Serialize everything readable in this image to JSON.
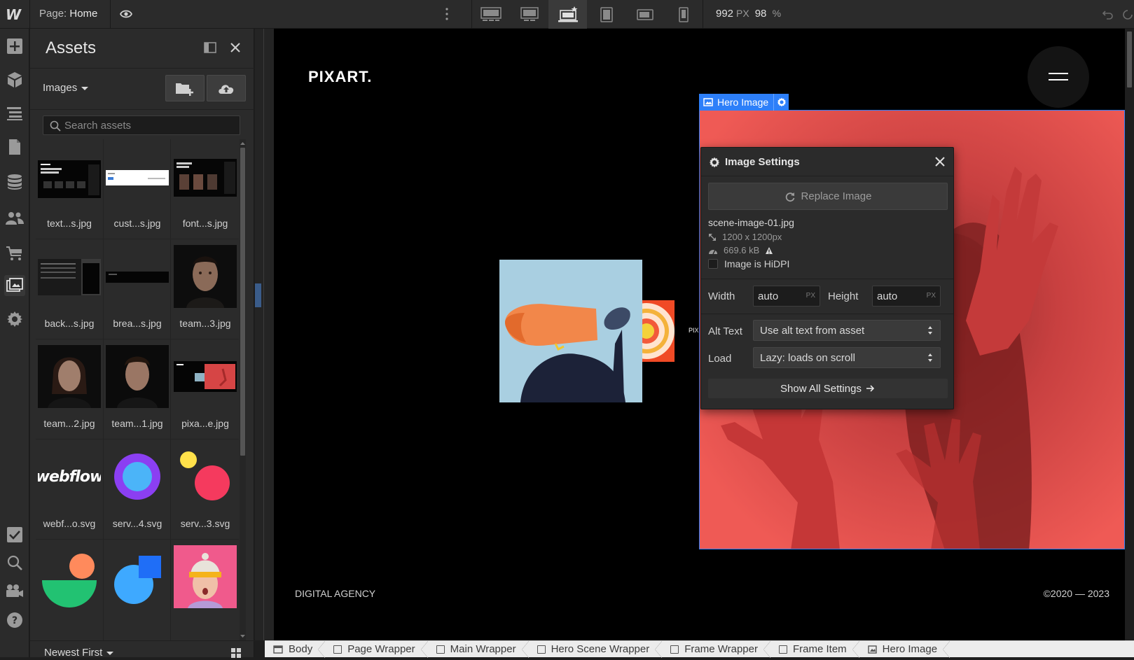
{
  "topbar": {
    "logo": "W",
    "page_label": "Page:",
    "page_name": "Home",
    "width_value": "992",
    "width_unit": "PX",
    "zoom_value": "98",
    "zoom_unit": "%",
    "breakpoints": [
      "desktop-large-icon",
      "desktop-icon",
      "laptop-base-icon",
      "tablet-icon",
      "mobile-landscape-icon",
      "mobile-portrait-icon"
    ],
    "active_breakpoint": "laptop-base-icon"
  },
  "leftbar": {
    "items": [
      "add-icon",
      "navigator-cube-icon",
      "style-list-icon",
      "pages-icon",
      "cms-database-icon",
      "users-icon",
      "ecommerce-cart-icon",
      "assets-icon",
      "settings-gear-icon"
    ],
    "bottom_items": [
      "checklist-icon",
      "search-icon",
      "video-tutorials-icon",
      "help-icon"
    ]
  },
  "assets_panel": {
    "title": "Assets",
    "filter": "Images",
    "search_placeholder": "Search assets",
    "sort": "Newest First",
    "assets": [
      {
        "name": "text...s.jpg"
      },
      {
        "name": "cust...s.jpg"
      },
      {
        "name": "font...s.jpg"
      },
      {
        "name": "back...s.jpg"
      },
      {
        "name": "brea...s.jpg"
      },
      {
        "name": "team...3.jpg"
      },
      {
        "name": "team...2.jpg"
      },
      {
        "name": "team...1.jpg"
      },
      {
        "name": "pixa...e.jpg"
      },
      {
        "name": "webf...o.svg",
        "thumb_text": "webflow"
      },
      {
        "name": "serv...4.svg"
      },
      {
        "name": "serv...3.svg"
      },
      {
        "name": ""
      },
      {
        "name": ""
      },
      {
        "name": ""
      }
    ]
  },
  "canvas": {
    "brand": "PIXART.",
    "footer_left": "DIGITAL AGENCY",
    "footer_right": "©2020 — 2023",
    "side_label": "PIX",
    "selected_label": "Hero Image"
  },
  "image_settings": {
    "title": "Image Settings",
    "replace_label": "Replace Image",
    "file_name": "scene-image-01.jpg",
    "dimensions": "1200 x 1200px",
    "file_size": "669.6 kB",
    "hidpi_label": "Image is HiDPI",
    "hidpi_checked": false,
    "width_label": "Width",
    "width_value": "auto",
    "width_unit": "PX",
    "height_label": "Height",
    "height_value": "auto",
    "height_unit": "PX",
    "alt_label": "Alt Text",
    "alt_value": "Use alt text from asset",
    "load_label": "Load",
    "load_value": "Lazy: loads on scroll",
    "show_all_label": "Show All Settings"
  },
  "breadcrumbs": [
    {
      "label": "Body",
      "icon": "body-icon"
    },
    {
      "label": "Page Wrapper",
      "icon": "div-block-icon"
    },
    {
      "label": "Main Wrapper",
      "icon": "div-block-icon"
    },
    {
      "label": "Hero Scene Wrapper",
      "icon": "div-block-icon"
    },
    {
      "label": "Frame Wrapper",
      "icon": "div-block-icon"
    },
    {
      "label": "Frame Item",
      "icon": "div-block-icon"
    },
    {
      "label": "Hero Image",
      "icon": "image-icon"
    }
  ]
}
